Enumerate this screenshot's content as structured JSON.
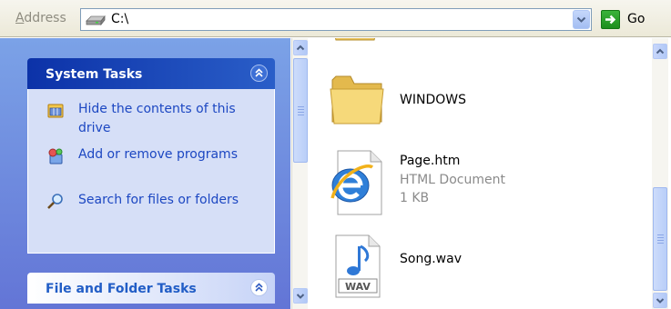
{
  "address_bar": {
    "label_underlined": "A",
    "label_rest": "ddress",
    "path": "C:\\",
    "drive_icon": "hard-drive-icon",
    "go_label": "Go"
  },
  "task_pane": {
    "system_tasks": {
      "title": "System Tasks",
      "items": [
        {
          "icon": "hide-drive-icon",
          "label": "Hide the contents of this drive"
        },
        {
          "icon": "add-remove-programs-icon",
          "label": "Add or remove programs"
        },
        {
          "icon": "search-icon",
          "label": "Search for files or folders"
        }
      ]
    },
    "file_and_folder_tasks": {
      "title": "File and Folder Tasks"
    }
  },
  "files": [
    {
      "name": "WINDOWS",
      "type": "",
      "size": "",
      "icon": "folder-icon"
    },
    {
      "name": "Page.htm",
      "type": "HTML Document",
      "size": "1 KB",
      "icon": "internet-explorer-icon"
    },
    {
      "name": "Song.wav",
      "type": "",
      "size": "",
      "icon": "wav-audio-icon"
    }
  ],
  "colors": {
    "pane_gradient_top": "#7ba2e7",
    "pane_gradient_bottom": "#6375d6",
    "system_tasks_header": "#0c32a8",
    "task_link": "#1c47c2",
    "panel_body": "#d6dff7"
  }
}
